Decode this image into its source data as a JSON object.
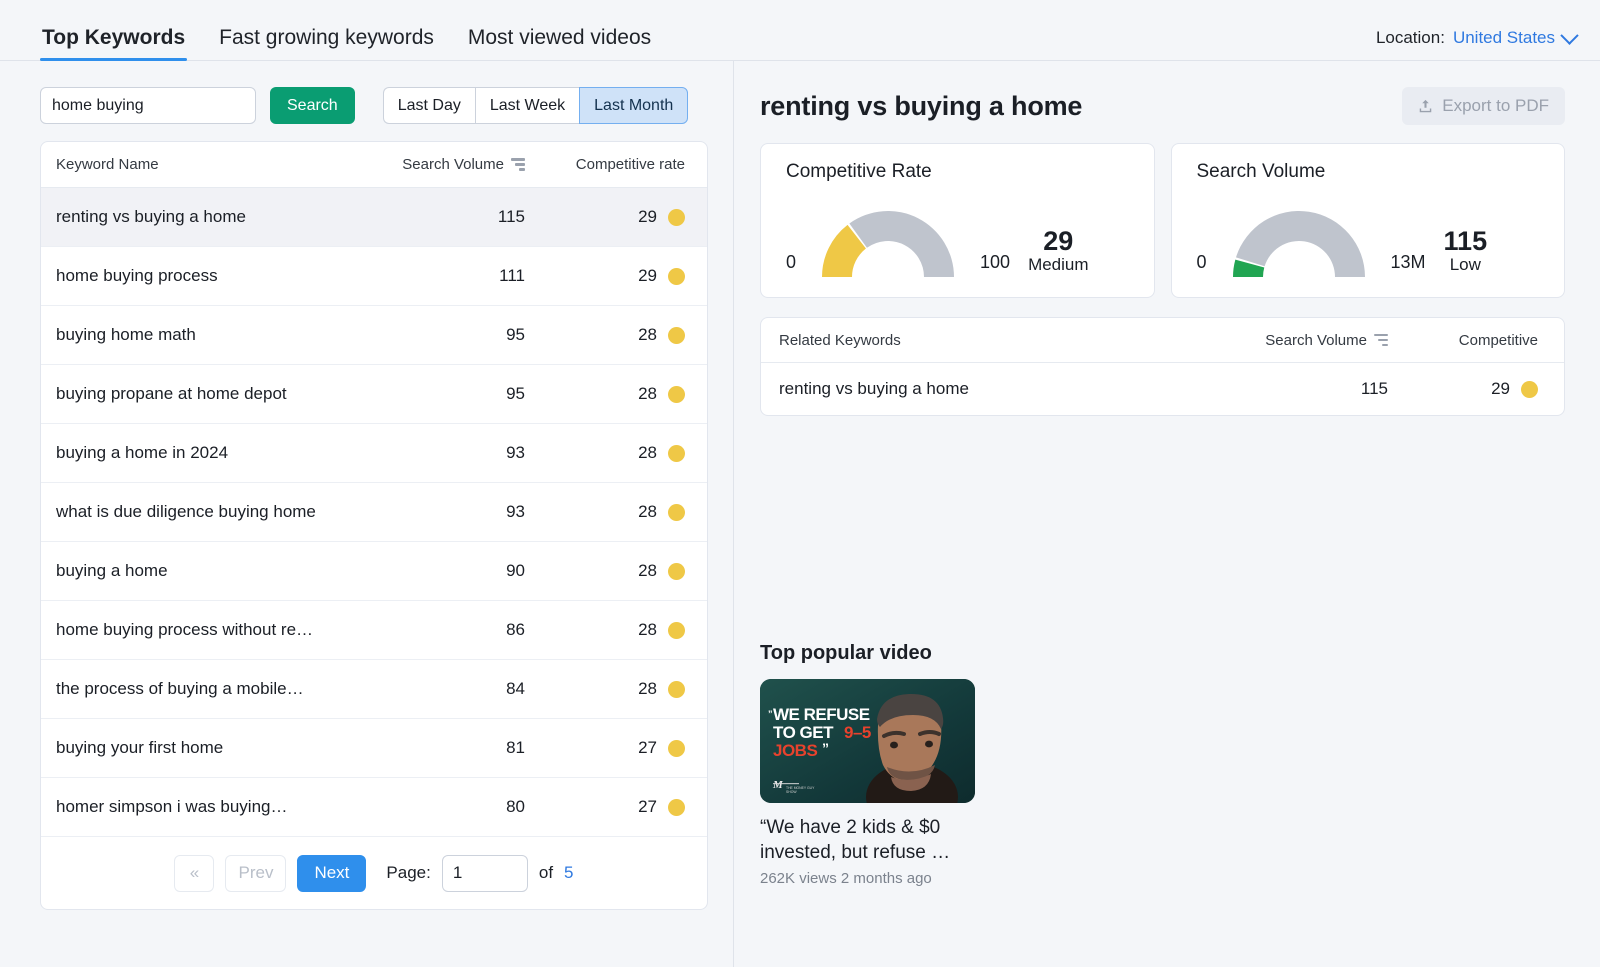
{
  "tabs": [
    {
      "label": "Top Keywords",
      "active": true
    },
    {
      "label": "Fast growing keywords",
      "active": false
    },
    {
      "label": "Most viewed videos",
      "active": false
    }
  ],
  "location": {
    "label": "Location:",
    "value": "United States"
  },
  "controls": {
    "search_value": "home buying",
    "search_placeholder": "Enter keyword",
    "search_button": "Search",
    "ranges": [
      {
        "label": "Last Day",
        "active": false
      },
      {
        "label": "Last Week",
        "active": false
      },
      {
        "label": "Last Month",
        "active": true
      }
    ]
  },
  "keyword_table": {
    "columns": {
      "name": "Keyword Name",
      "volume": "Search Volume",
      "competitive": "Competitive rate"
    },
    "rows": [
      {
        "name": "renting vs buying a home",
        "volume": "115",
        "competitive": "29",
        "selected": true
      },
      {
        "name": "home buying process",
        "volume": "111",
        "competitive": "29",
        "selected": false
      },
      {
        "name": "buying home math",
        "volume": "95",
        "competitive": "28",
        "selected": false
      },
      {
        "name": "buying propane at home depot",
        "volume": "95",
        "competitive": "28",
        "selected": false
      },
      {
        "name": "buying a home in 2024",
        "volume": "93",
        "competitive": "28",
        "selected": false
      },
      {
        "name": "what is due diligence buying home",
        "volume": "93",
        "competitive": "28",
        "selected": false
      },
      {
        "name": "buying a home",
        "volume": "90",
        "competitive": "28",
        "selected": false
      },
      {
        "name": "home buying process without re…",
        "volume": "86",
        "competitive": "28",
        "selected": false
      },
      {
        "name": "the process of buying a mobile…",
        "volume": "84",
        "competitive": "28",
        "selected": false
      },
      {
        "name": "buying your first home",
        "volume": "81",
        "competitive": "27",
        "selected": false
      },
      {
        "name": "homer simpson i was buying…",
        "volume": "80",
        "competitive": "27",
        "selected": false
      }
    ]
  },
  "pagination": {
    "first_label": "«",
    "prev_label": "Prev",
    "next_label": "Next",
    "page_label": "Page:",
    "page_value": "1",
    "of_label": "of",
    "total_pages": "5"
  },
  "detail": {
    "title": "renting vs buying a home",
    "export_label": "Export to PDF"
  },
  "chart_data": [
    {
      "type": "gauge",
      "title": "Competitive Rate",
      "value": 29,
      "min": 0,
      "max": 100,
      "min_label": "0",
      "max_label": "100",
      "value_label": "29",
      "level": "Medium",
      "fill_color": "#efc846",
      "track_color": "#bfc4cd",
      "fill_fraction": 0.29
    },
    {
      "type": "gauge",
      "title": "Search Volume",
      "value": 115,
      "min": 0,
      "max": 13000000,
      "min_label": "0",
      "max_label": "13M",
      "value_label": "115",
      "level": "Low",
      "fill_color": "#21a552",
      "track_color": "#bfc4cd",
      "fill_fraction": 0.085
    }
  ],
  "related_table": {
    "columns": {
      "name": "Related Keywords",
      "volume": "Search Volume",
      "competitive": "Competitive"
    },
    "rows": [
      {
        "name": "renting vs buying a home",
        "volume": "115",
        "competitive": "29"
      }
    ]
  },
  "video": {
    "section_title": "Top popular video",
    "thumbnail_text_1": "“WE REFUSE",
    "thumbnail_text_2": "TO GET",
    "thumbnail_text_3": "9–5",
    "thumbnail_text_4": "JOBS”",
    "caption": "“We have 2 kids & $0 invested, but refuse …",
    "meta": "262K views 2 months ago"
  }
}
